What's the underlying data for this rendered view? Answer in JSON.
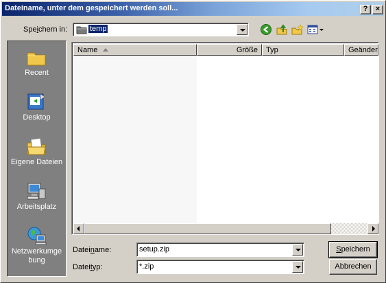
{
  "window": {
    "title": "Dateiname, unter dem gespeichert werden soll...",
    "help_label": "?",
    "close_label": "×"
  },
  "toolbar": {
    "save_in_label_a": "Spe",
    "save_in_label_u": "i",
    "save_in_label_b": "chern in:",
    "location_value": "temp",
    "icons": [
      "back-icon",
      "up-folder-icon",
      "new-folder-icon",
      "view-menu-icon"
    ]
  },
  "places": [
    {
      "label": "Recent",
      "icon": "recent-icon"
    },
    {
      "label": "Desktop",
      "icon": "desktop-icon"
    },
    {
      "label": "Eigene Dateien",
      "icon": "my-documents-icon"
    },
    {
      "label": "Arbeitsplatz",
      "icon": "my-computer-icon"
    },
    {
      "label": "Netzwerkumge bung",
      "icon": "network-icon"
    }
  ],
  "filelist": {
    "columns": [
      "Name",
      "Größe",
      "Typ",
      "Geändert"
    ],
    "rows": []
  },
  "filename": {
    "label_a": "Datei",
    "label_u": "n",
    "label_b": "ame:",
    "value": "setup.zip"
  },
  "filetype": {
    "label_a": "Datei",
    "label_u": "t",
    "label_b": "yp:",
    "value": "*.zip"
  },
  "buttons": {
    "save_u": "S",
    "save_rest": "peichern",
    "cancel": "Abbrechen"
  }
}
